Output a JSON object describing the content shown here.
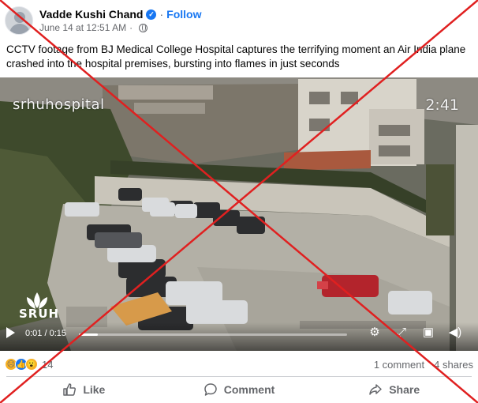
{
  "post": {
    "author": "Vadde Kushi Chand",
    "follow_label": "Follow",
    "separator": "·",
    "timestamp": "June 14 at 12:51 AM",
    "caption": "CCTV footage from BJ Medical College Hospital captures the terrifying moment an Air India plane crashed into the hospital premises, bursting into flames in just seconds"
  },
  "video": {
    "watermark": "srhuhospital",
    "overlay_time": "2:41",
    "logo_text": "SRUH",
    "time_display": "0:01 / 0:15",
    "progress_fraction": 0.07,
    "icons": [
      "play-icon",
      "settings-icon",
      "fullscreen-icon",
      "pip-icon",
      "volume-icon"
    ]
  },
  "engagement": {
    "reaction_count": "14",
    "comments": "1 comment",
    "shares": "4 shares"
  },
  "actions": {
    "like": "Like",
    "comment": "Comment",
    "share": "Share"
  },
  "colors": {
    "accent": "#1877f2",
    "cross": "#e02020"
  }
}
